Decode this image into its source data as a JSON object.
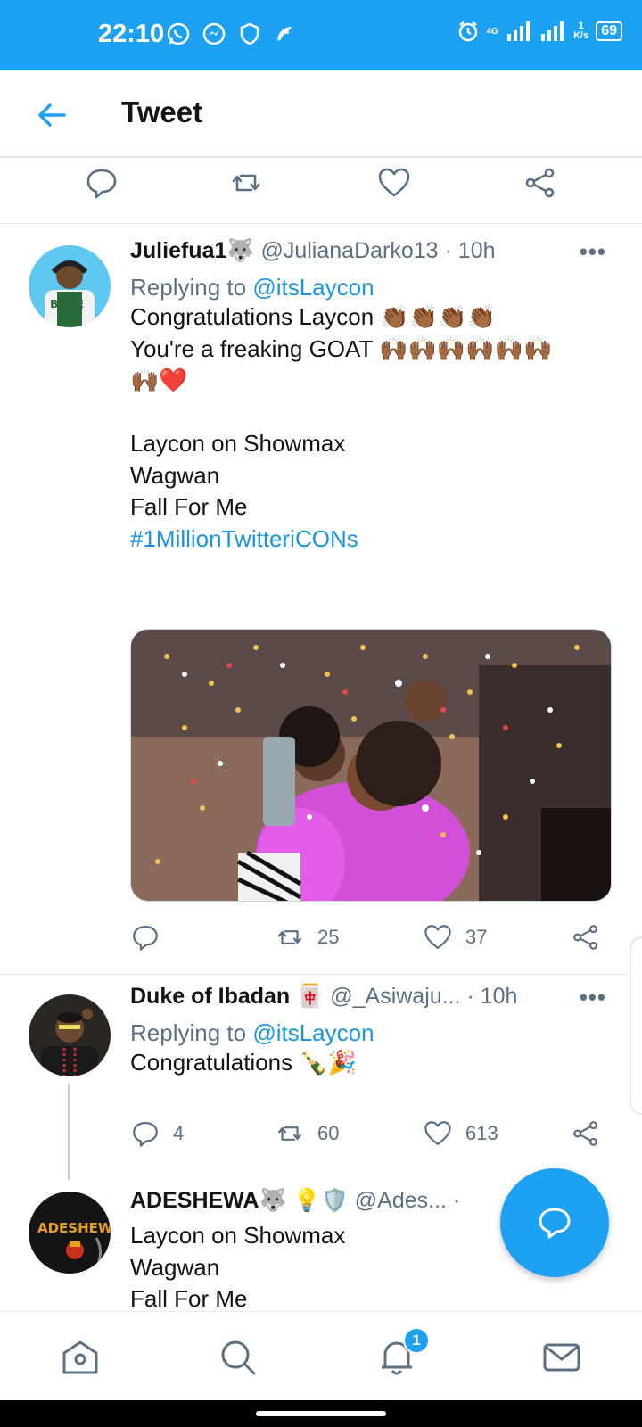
{
  "status_bar": {
    "time": "22:10",
    "battery": "69",
    "network_speed": "1\nK/s",
    "network_type": "4G"
  },
  "header": {
    "title": "Tweet"
  },
  "tweets": [
    {
      "name": "Juliefua1",
      "name_emoji": "🐺",
      "handle": "@JulianaDarko13",
      "time": "· 10h",
      "reply_prefix": "Replying to ",
      "reply_to": "@itsLaycon",
      "body": "Congratulations Laycon 👏🏾👏🏾👏🏾👏🏾\nYou're a freaking  GOAT  🙌🏾🙌🏾🙌🏾🙌🏾🙌🏾🙌🏾\n🙌🏾❤️\n\nLaycon on Showmax\nWagwan\nFall For Me\n",
      "hashtag": "#1MillionTwitteriCONs",
      "retweets": "25",
      "likes": "37"
    },
    {
      "name": "Duke of Ibadan",
      "name_emoji": "🀄",
      "handle": "@_Asiwaju...",
      "time": "· 10h",
      "reply_prefix": "Replying to ",
      "reply_to": "@itsLaycon",
      "body": "Congratulations 🍾🎉",
      "replies": "4",
      "retweets": "60",
      "likes": "613"
    },
    {
      "name": "ADESHEWA",
      "name_emoji": "🐺 💡🛡️",
      "handle": "@Ades...",
      "time": "·",
      "body": "Laycon on Showmax\nWagwan\nFall For Me"
    }
  ],
  "more_label": "•••",
  "notification_badge": "1",
  "colors": {
    "brand": "#1da1f2",
    "link": "#1b95e0",
    "muted": "#5b7083",
    "like_heart": "#e0245e"
  },
  "icons": [
    "back-arrow-icon",
    "reply-icon",
    "retweet-icon",
    "like-icon",
    "share-icon",
    "more-icon",
    "compose-icon",
    "home-icon",
    "search-icon",
    "notifications-icon",
    "messages-icon",
    "whatsapp-icon",
    "messenger-icon",
    "shield-icon",
    "alarm-icon",
    "signal-icon"
  ]
}
